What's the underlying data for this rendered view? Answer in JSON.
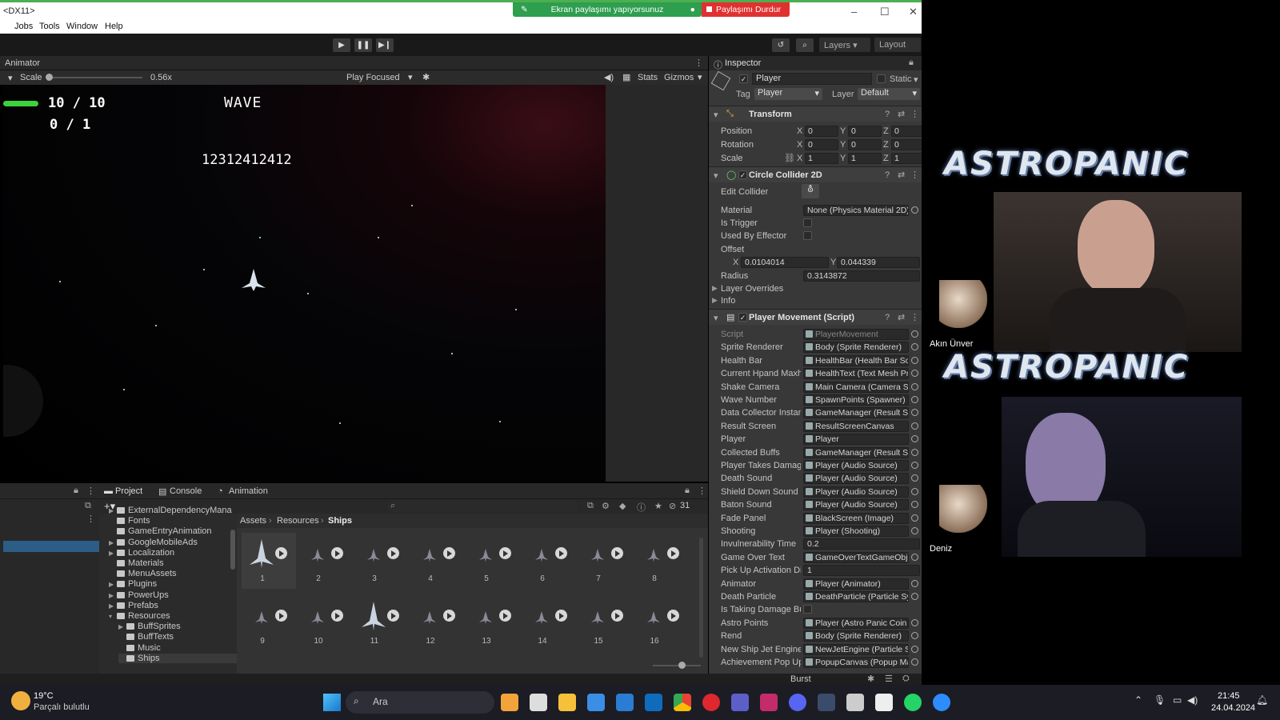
{
  "window": {
    "title": "<DX11>",
    "share_notice": "Ekran paylaşımı yapıyorsunuz",
    "stop_share": "Paylaşımı Durdur"
  },
  "menu": [
    "Jobs",
    "Tools",
    "Window",
    "Help"
  ],
  "toolbar": {
    "layers": "Layers",
    "layout": "Layout"
  },
  "game": {
    "tab": "Animator",
    "scale_label": "Scale",
    "scale_value": "0.56x",
    "play_focused": "Play Focused",
    "stats": "Stats",
    "gizmos": "Gizmos",
    "health_text": "10 / 10",
    "secondary_counter": "0 / 1",
    "wave_label": "WAVE",
    "score": "12312412412"
  },
  "inspector": {
    "tab": "Inspector",
    "object_name": "Player",
    "static_label": "Static",
    "tag_label": "Tag",
    "tag_value": "Player",
    "layer_label": "Layer",
    "layer_value": "Default",
    "transform": {
      "title": "Transform",
      "rows": [
        {
          "label": "Position",
          "x": "0",
          "y": "0",
          "z": "0"
        },
        {
          "label": "Rotation",
          "x": "0",
          "y": "0",
          "z": "0"
        },
        {
          "label": "Scale",
          "x": "1",
          "y": "1",
          "z": "1"
        }
      ]
    },
    "collider": {
      "title": "Circle Collider 2D",
      "edit_collider": "Edit Collider",
      "material_label": "Material",
      "material_value": "None (Physics Material 2D)",
      "is_trigger": "Is Trigger",
      "used_by_effector": "Used By Effector",
      "offset_label": "Offset",
      "offset_x": "0.0104014",
      "offset_y": "0.044339",
      "radius_label": "Radius",
      "radius_value": "0.3143872",
      "layer_overrides": "Layer Overrides",
      "info": "Info"
    },
    "movement": {
      "title": "Player Movement (Script)",
      "fields": [
        {
          "label": "Script",
          "value": "PlayerMovement"
        },
        {
          "label": "Sprite Renderer",
          "value": "Body (Sprite Renderer)"
        },
        {
          "label": "Health Bar",
          "value": "HealthBar (Health Bar Scr"
        },
        {
          "label": "Current Hpand Maxh",
          "value": "HealthText (Text Mesh Pr"
        },
        {
          "label": "Shake Camera",
          "value": "Main Camera (Camera Sh"
        },
        {
          "label": "Wave Number",
          "value": "SpawnPoints (Spawner)"
        },
        {
          "label": "Data Collector Instan",
          "value": "GameManager (Result Sc"
        },
        {
          "label": "Result Screen",
          "value": "ResultScreenCanvas"
        },
        {
          "label": "Player",
          "value": "Player"
        },
        {
          "label": "Collected Buffs",
          "value": "GameManager (Result Sc"
        },
        {
          "label": "Player Takes Damage",
          "value": "Player (Audio Source)"
        },
        {
          "label": "Death Sound",
          "value": "Player (Audio Source)"
        },
        {
          "label": "Shield Down Sound",
          "value": "Player (Audio Source)"
        },
        {
          "label": "Baton Sound",
          "value": "Player (Audio Source)"
        },
        {
          "label": "Fade Panel",
          "value": "BlackScreen (Image)"
        },
        {
          "label": "Shooting",
          "value": "Player (Shooting)"
        },
        {
          "label": "Invulnerability Time",
          "value": "0.2"
        },
        {
          "label": "Game Over Text",
          "value": "GameOverTextGameObje"
        },
        {
          "label": "Pick Up Activation Di",
          "value": "1"
        },
        {
          "label": "Animator",
          "value": "Player (Animator)"
        },
        {
          "label": "Death Particle",
          "value": "DeathParticle (Particle Sy"
        },
        {
          "label": "Is Taking Damage Bu",
          "value": ""
        },
        {
          "label": "Astro Points",
          "value": "Player (Astro Panic Coin C"
        },
        {
          "label": "Rend",
          "value": "Body (Sprite Renderer)"
        },
        {
          "label": "New Ship Jet Engine",
          "value": "NewJetEngine (Particle S"
        },
        {
          "label": "Achievement Pop Up",
          "value": "PopupCanvas (Popup Ma"
        }
      ]
    }
  },
  "project": {
    "tabs": [
      "Project",
      "Console",
      "Animation"
    ],
    "item_count": "31",
    "breadcrumb": [
      "Assets",
      "Resources",
      "Ships"
    ],
    "tree": [
      "ExternalDependencyMana",
      "Fonts",
      "GameEntryAnimation",
      "GoogleMobileAds",
      "Localization",
      "Materials",
      "MenuAssets",
      "Plugins",
      "PowerUps",
      "Prefabs",
      "Resources",
      "BuffSprites",
      "BuffTexts",
      "Music",
      "Ships"
    ],
    "assets": [
      "1",
      "2",
      "3",
      "4",
      "5",
      "6",
      "7",
      "8",
      "9",
      "10",
      "11",
      "12",
      "13",
      "14",
      "15",
      "16"
    ]
  },
  "status": {
    "burst": "Burst"
  },
  "stream": {
    "logo": "ASTROPANIC",
    "participant1": "Akın Ünver",
    "participant2": "Deniz"
  },
  "taskbar": {
    "temp": "19°C",
    "weather": "Parçalı bulutlu",
    "search": "Ara",
    "time": "21:45",
    "date": "24.04.2024"
  }
}
